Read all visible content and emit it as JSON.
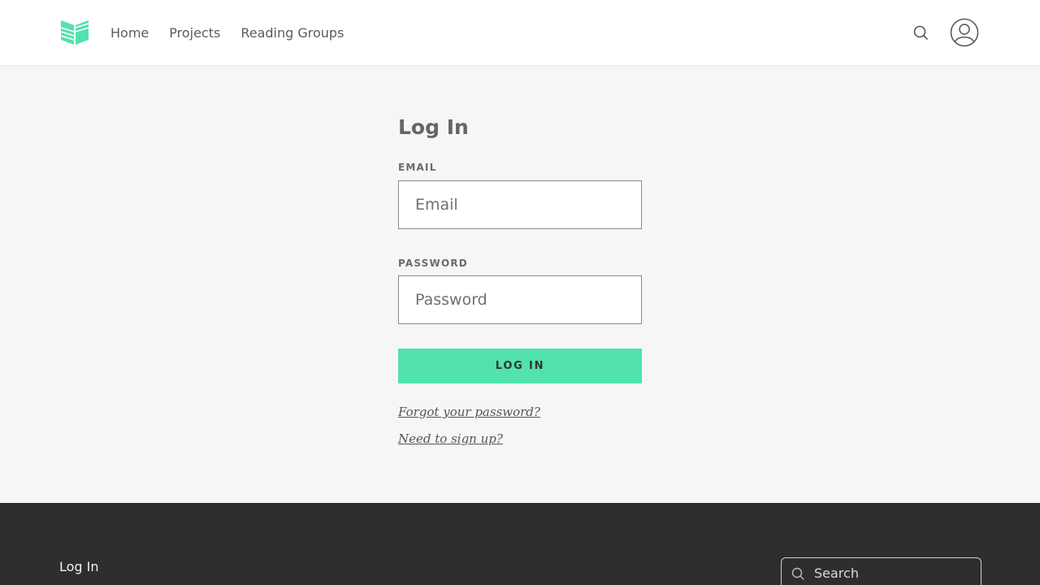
{
  "brand": {
    "accent": "#52e3ac"
  },
  "nav": {
    "items": [
      {
        "label": "Home"
      },
      {
        "label": "Projects"
      },
      {
        "label": "Reading Groups"
      }
    ],
    "search_icon": "search-icon",
    "avatar_icon": "user-avatar-icon"
  },
  "login": {
    "title": "Log In",
    "email_label": "EMAIL",
    "email_placeholder": "Email",
    "email_value": "",
    "password_label": "PASSWORD",
    "password_placeholder": "Password",
    "password_value": "",
    "submit_label": "LOG IN",
    "forgot_link": "Forgot your password?",
    "signup_link": "Need to sign up?"
  },
  "footer": {
    "link": "Log In",
    "search_placeholder": "Search"
  }
}
